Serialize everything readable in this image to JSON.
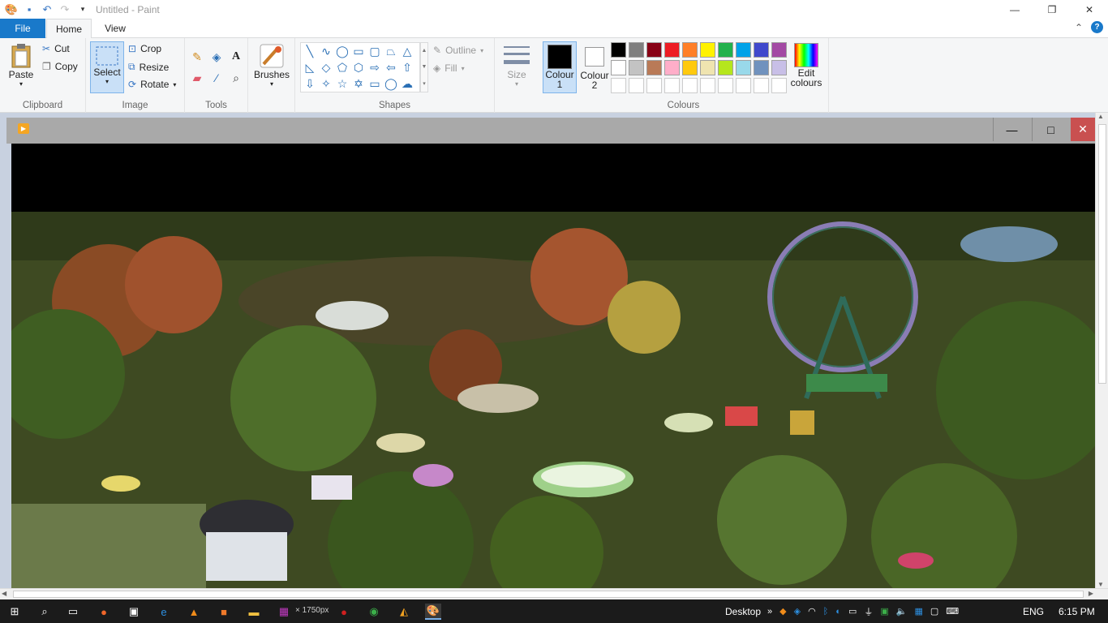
{
  "window": {
    "title": "Untitled - Paint",
    "minimize": "—",
    "maximize": "❐",
    "close": "✕"
  },
  "tabs": {
    "file": "File",
    "home": "Home",
    "view": "View",
    "help": "?"
  },
  "clipboard": {
    "paste": "Paste",
    "cut": "Cut",
    "copy": "Copy",
    "group": "Clipboard"
  },
  "image": {
    "select": "Select",
    "crop": "Crop",
    "resize": "Resize",
    "rotate": "Rotate",
    "group": "Image"
  },
  "tools": {
    "group": "Tools"
  },
  "brushes": {
    "label": "Brushes"
  },
  "shapes": {
    "outline": "Outline",
    "fill": "Fill",
    "group": "Shapes"
  },
  "size": {
    "label": "Size"
  },
  "colours": {
    "colour1_line1": "Colour",
    "colour1_line2": "1",
    "colour2_line1": "Colour",
    "colour2_line2": "2",
    "edit_line1": "Edit",
    "edit_line2": "colours",
    "group": "Colours",
    "colour1": "#000000",
    "colour2": "#ffffff",
    "palette_row1": [
      "#000000",
      "#7f7f7f",
      "#880015",
      "#ed1c24",
      "#ff7f27",
      "#fff200",
      "#22b14c",
      "#00a2e8",
      "#3f48cc",
      "#a349a4"
    ],
    "palette_row2": [
      "#ffffff",
      "#c3c3c3",
      "#b97a57",
      "#ffaec9",
      "#ffc90e",
      "#efe4b0",
      "#b5e61d",
      "#99d9ea",
      "#7092be",
      "#c8bfe7"
    ]
  },
  "embedded": {
    "minimize": "—",
    "maximize": "□",
    "close": "✕"
  },
  "taskbar": {
    "desktop": "Desktop",
    "lang": "ENG",
    "time": "6:15 PM",
    "status": "× 1750px"
  }
}
